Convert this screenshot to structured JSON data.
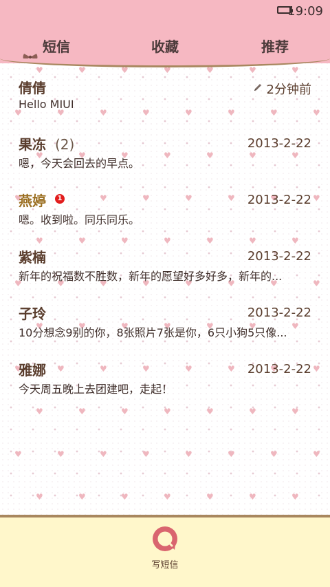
{
  "statusbar": {
    "time": "19:09"
  },
  "tabs": [
    {
      "label": "短信"
    },
    {
      "label": "收藏"
    },
    {
      "label": "推荐"
    }
  ],
  "messages": [
    {
      "name": "倩倩",
      "count": "",
      "date": "2分钟前",
      "snippet": "Hello MIUI",
      "has_unread": false
    },
    {
      "name": "果冻",
      "count": "(2)",
      "date": "2013-2-22",
      "snippet": "嗯，今天会回去的早点。",
      "has_unread": false
    },
    {
      "name": "燕婷",
      "count": "",
      "date": "2013-2-22",
      "snippet": "嗯。收到啦。同乐同乐。",
      "has_unread": true,
      "unread_badge": "1"
    },
    {
      "name": "紫楠",
      "count": "",
      "date": "2013-2-22",
      "snippet": "新年的祝福数不胜数，新年的愿望好多好多，新年的...",
      "has_unread": false
    },
    {
      "name": "子玲",
      "count": "",
      "date": "2013-2-22",
      "snippet": "10分想念9别的你，8张照片7张是你，6只小狗5只像...",
      "has_unread": false
    },
    {
      "name": "雅娜",
      "count": "",
      "date": "2013-2-22",
      "snippet": "今天周五晚上去团建吧，走起！",
      "has_unread": false
    }
  ],
  "bottom_bar": {
    "compose_label": "写短信"
  },
  "colors": {
    "header_pink": "#f6b8c2",
    "bottom_cream": "#fff7cb",
    "name_brown": "#5a3d2d",
    "unread_name_gold": "#9b6f22",
    "unread_red": "#e21d1d",
    "divider_brown": "#a8875f"
  },
  "icons": {
    "battery": "battery-icon",
    "bow": "bow-icon",
    "pencil": "pencil-icon",
    "compose": "compose-bubble-icon"
  }
}
